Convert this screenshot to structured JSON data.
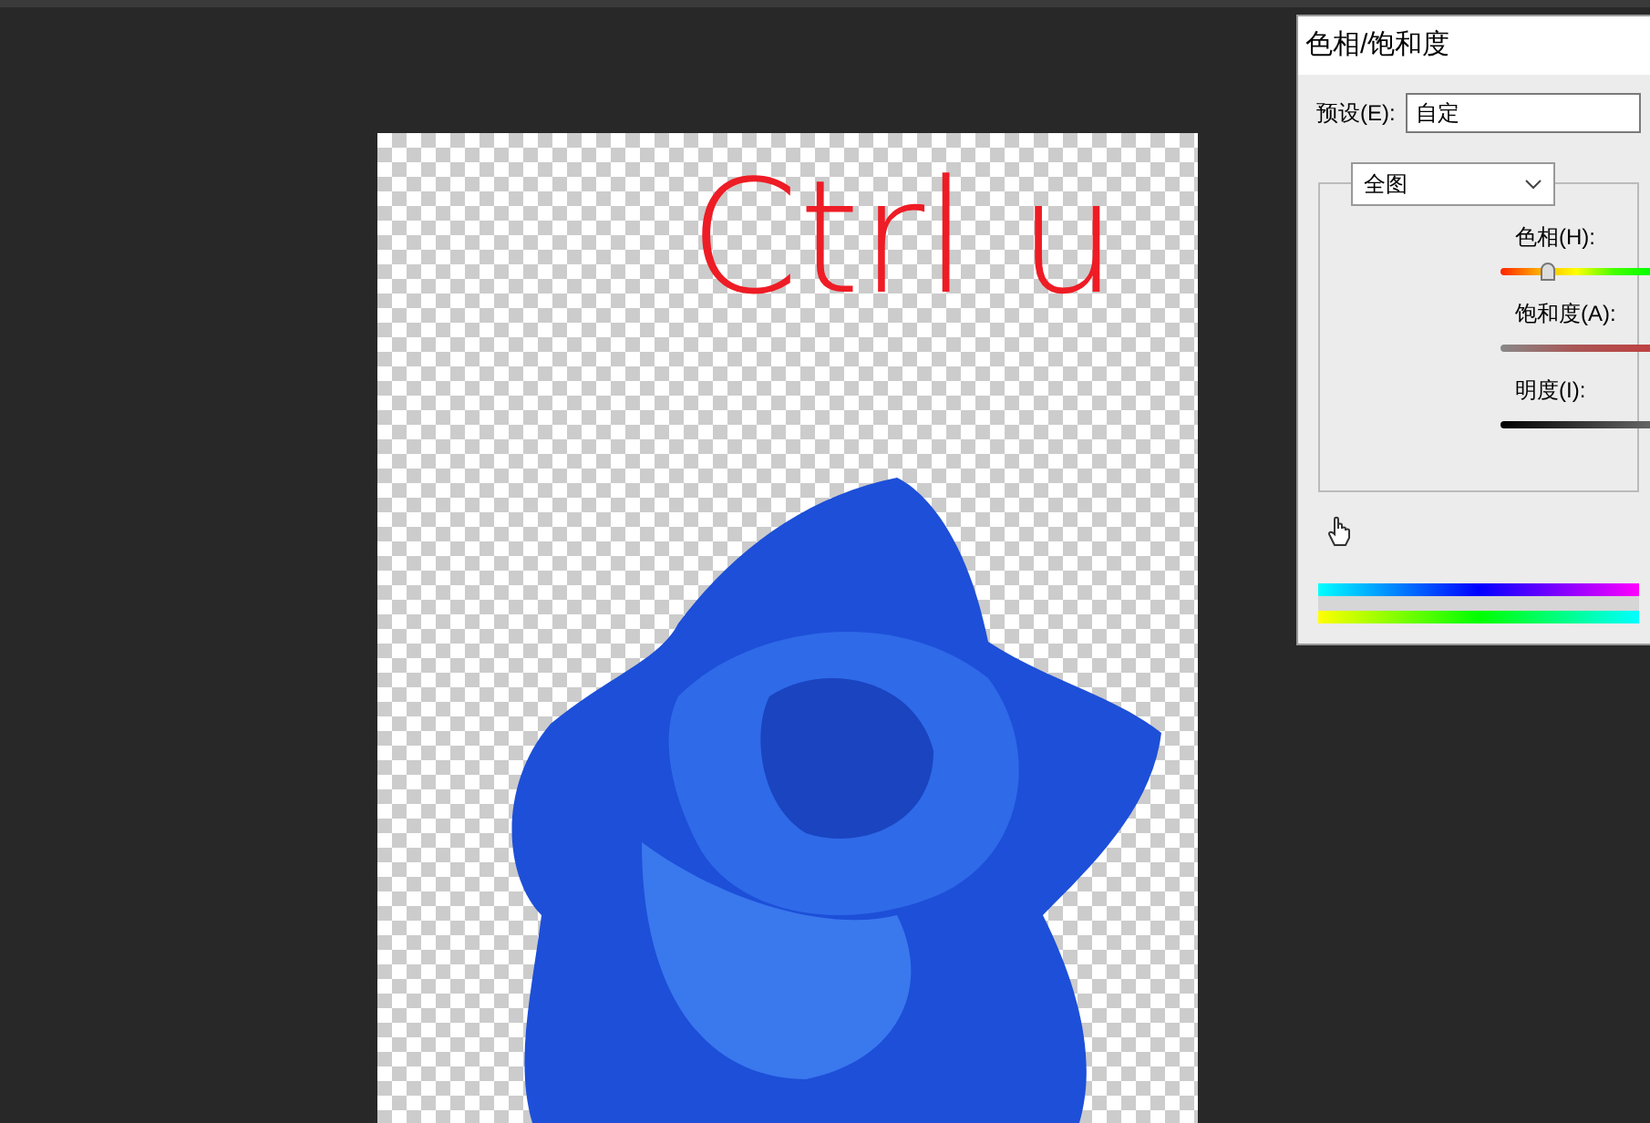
{
  "canvas": {
    "annotation": "Ctrl u"
  },
  "dialog": {
    "title": "色相/饱和度",
    "preset": {
      "label": "预设(E):",
      "value": "自定"
    },
    "channel": {
      "value": "全图"
    },
    "sliders": [
      {
        "label": "色相(H):",
        "kind": "hue",
        "level": 0.31
      },
      {
        "label": "饱和度(A):",
        "kind": "saturation"
      },
      {
        "label": "明度(I):",
        "kind": "lightness"
      }
    ]
  }
}
